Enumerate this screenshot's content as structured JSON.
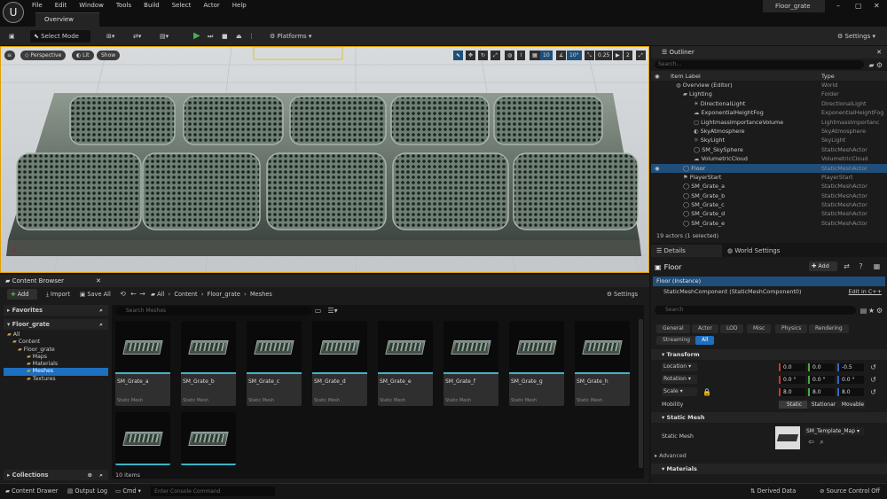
{
  "menu": [
    "File",
    "Edit",
    "Window",
    "Tools",
    "Build",
    "Select",
    "Actor",
    "Help"
  ],
  "window": {
    "tab": "Overview",
    "project": "Floor_grate"
  },
  "toolbar": {
    "mode": "Select Mode",
    "platforms": "Platforms",
    "settings": "Settings"
  },
  "viewport": {
    "perspective": "Perspective",
    "lit": "Lit",
    "show": "Show",
    "grid": "10",
    "angle": "10°",
    "scale": "0.25",
    "cams": "2"
  },
  "outliner": {
    "title": "Outliner",
    "search_placeholder": "Search...",
    "col_label": "Item Label",
    "col_type": "Type",
    "rows": [
      {
        "name": "Overview (Editor)",
        "type": "World"
      },
      {
        "name": "Lighting",
        "type": "Folder"
      },
      {
        "name": "DirectionalLight",
        "type": "DirectionalLight"
      },
      {
        "name": "ExponentialHeightFog",
        "type": "ExponentialHeightFog"
      },
      {
        "name": "LightmassImportanceVolume",
        "type": "LightmassImportanc"
      },
      {
        "name": "SkyAtmosphere",
        "type": "SkyAtmosphere"
      },
      {
        "name": "SkyLight",
        "type": "SkyLight"
      },
      {
        "name": "SM_SkySphere",
        "type": "StaticMeshActor"
      },
      {
        "name": "VolumetricCloud",
        "type": "VolumetricCloud"
      },
      {
        "name": "Floor",
        "type": "StaticMeshActor"
      },
      {
        "name": "PlayerStart",
        "type": "PlayerStart"
      },
      {
        "name": "SM_Grate_a",
        "type": "StaticMeshActor"
      },
      {
        "name": "SM_Grate_b",
        "type": "StaticMeshActor"
      },
      {
        "name": "SM_Grate_c",
        "type": "StaticMeshActor"
      },
      {
        "name": "SM_Grate_d",
        "type": "StaticMeshActor"
      },
      {
        "name": "SM_Grate_e",
        "type": "StaticMeshActor"
      }
    ],
    "status": "19 actors (1 selected)"
  },
  "details": {
    "tab1": "Details",
    "tab2": "World Settings",
    "actor": "Floor",
    "add": "Add",
    "instance": "Floor (Instance)",
    "component": "StaticMeshComponent (StaticMeshComponent0)",
    "edit_cpp": "Edit in C++",
    "search_placeholder": "Search",
    "filters": [
      "General",
      "Actor",
      "LOD",
      "Misc",
      "Physics",
      "Rendering",
      "Streaming",
      "All"
    ],
    "transform": "Transform",
    "location_label": "Location",
    "rotation_label": "Rotation",
    "scale_label": "Scale",
    "location": [
      "0.0",
      "0.0",
      "-0.5"
    ],
    "rotation": [
      "0.0 °",
      "0.0 °",
      "0.0 °"
    ],
    "scale": [
      "8.0",
      "8.0",
      "8.0"
    ],
    "mobility_label": "Mobility",
    "mobility": [
      "Static",
      "Stationar",
      "Movable"
    ],
    "static_mesh_section": "Static Mesh",
    "static_mesh_label": "Static Mesh",
    "static_mesh_value": "SM_Template_Map",
    "advanced": "Advanced",
    "materials": "Materials"
  },
  "content_browser": {
    "title": "Content Browser",
    "add": "Add",
    "import": "Import",
    "save_all": "Save All",
    "crumbs": [
      "All",
      "Content",
      "Floor_grate",
      "Meshes"
    ],
    "settings": "Settings",
    "favorites": "Favorites",
    "project": "Floor_grate",
    "tree": [
      "All",
      "Content",
      "Floor_grate",
      "Maps",
      "Materials",
      "Meshes",
      "Textures"
    ],
    "search_placeholder": "Search Meshes",
    "assets": [
      {
        "name": "SM_Grate_a",
        "type": "Static Mesh"
      },
      {
        "name": "SM_Grate_b",
        "type": "Static Mesh"
      },
      {
        "name": "SM_Grate_c",
        "type": "Static Mesh"
      },
      {
        "name": "SM_Grate_d",
        "type": "Static Mesh"
      },
      {
        "name": "SM_Grate_e",
        "type": "Static Mesh"
      },
      {
        "name": "SM_Grate_f",
        "type": "Static Mesh"
      },
      {
        "name": "SM_Grate_g",
        "type": "Static Mesh"
      },
      {
        "name": "SM_Grate_h",
        "type": "Static Mesh"
      },
      {
        "name": "",
        "type": ""
      },
      {
        "name": "",
        "type": ""
      }
    ],
    "count": "10 items",
    "collections": "Collections"
  },
  "statusbar": {
    "drawer": "Content Drawer",
    "output": "Output Log",
    "cmd": "Cmd",
    "console_placeholder": "Enter Console Command",
    "derived": "Derived Data",
    "source": "Source Control Off"
  },
  "colors": {
    "accent": "#3fb3c5",
    "selection": "#1f4e7a",
    "play": "#4caf50"
  }
}
